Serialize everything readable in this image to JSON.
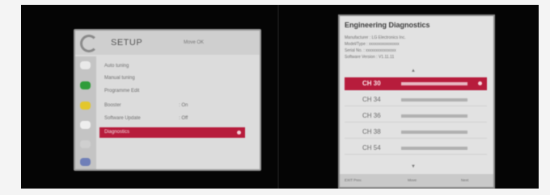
{
  "left_screen": {
    "title": "SETUP",
    "hint": "Move  OK",
    "icon_colors": [
      "#e9e9e9",
      "#2f9c3a",
      "#e3c72d",
      "#eeeeee",
      "#cfcfcf",
      "#6f7fb8"
    ],
    "menu_items": [
      {
        "label": "Auto tuning",
        "value": ""
      },
      {
        "label": "Manual tuning",
        "value": ""
      },
      {
        "label": "Programme Edit",
        "value": ""
      },
      {
        "label": "Booster",
        "value": ": On"
      },
      {
        "label": "Software Update",
        "value": ": Off"
      }
    ],
    "selected_item": "Diagnostics"
  },
  "right_screen": {
    "title": "Engineering Diagnostics",
    "info_lines": [
      "Manufacturer : LG Electronics Inc.",
      "Model/Type : xxxxxxxxxxxxxxx",
      "Serial No. : xxxxxxxxxxxxxxx",
      "Software Version : V1.11.11"
    ],
    "channels": [
      "CH 30",
      "CH 34",
      "CH 36",
      "CH 38",
      "CH 54"
    ],
    "selected_channel": "CH 30",
    "footer": [
      "EXIT Prev.",
      "Move",
      "Next"
    ]
  }
}
